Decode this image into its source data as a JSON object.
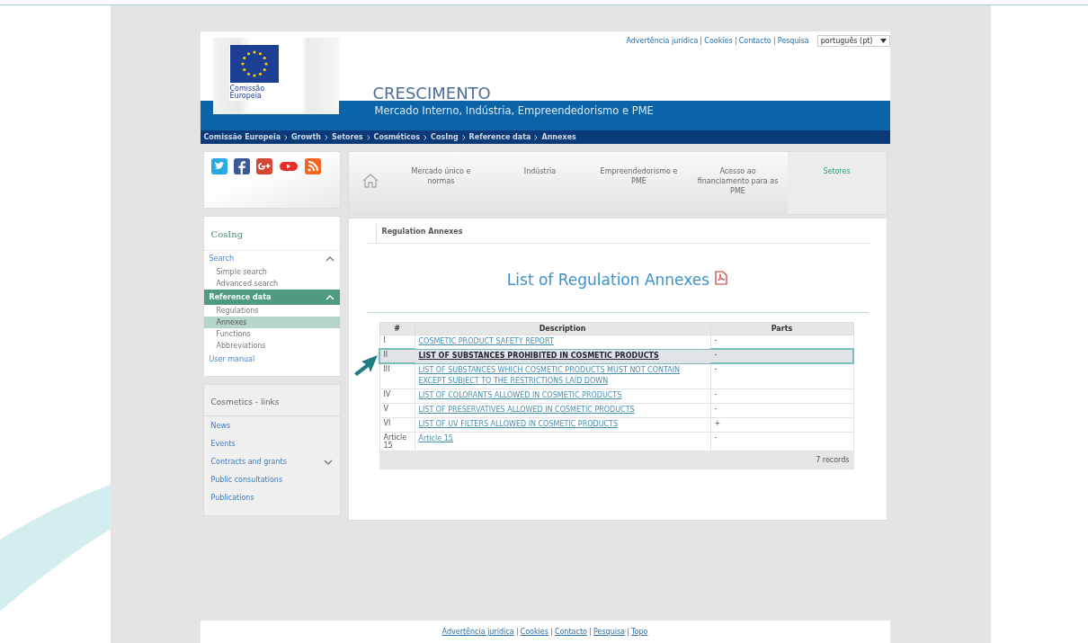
{
  "top_links": [
    "Advertência jurídica",
    "Cookies",
    "Contacto",
    "Pesquisa"
  ],
  "language_select": {
    "value": "português (pt)"
  },
  "logo_caption": "Comissão Europeia",
  "site_title": "CRESCIMENTO",
  "site_subtitle": "Mercado Interno, Indústria, Empreendedorismo e PME",
  "breadcrumb": [
    "Comissão Europeia",
    "Growth",
    "Setores",
    "Cosméticos",
    "CosIng",
    "Reference data",
    "Annexes"
  ],
  "social_icons": [
    {
      "kind": "twitter"
    },
    {
      "kind": "facebook"
    },
    {
      "kind": "googleplus"
    },
    {
      "kind": "youtube"
    },
    {
      "kind": "rss"
    }
  ],
  "nav": [
    {
      "label": "Mercado único e normas",
      "selected": false
    },
    {
      "label": "Indústria",
      "selected": false
    },
    {
      "label": "Empreendedorismo e PME",
      "selected": false
    },
    {
      "label": "Acesso ao financiamento para as PME",
      "selected": false
    },
    {
      "label": "Setores",
      "selected": true
    }
  ],
  "sidebar": {
    "title": "CosIng",
    "groups": [
      {
        "label": "Search",
        "kind": "section",
        "expanded": true,
        "active": false,
        "children": [
          {
            "label": "Simple search",
            "selected": false
          },
          {
            "label": "Advanced search",
            "selected": false
          }
        ]
      },
      {
        "label": "Reference data",
        "kind": "section",
        "expanded": true,
        "active": true,
        "children": [
          {
            "label": "Regulations",
            "selected": false
          },
          {
            "label": "Annexes",
            "selected": true
          },
          {
            "label": "Functions",
            "selected": false
          },
          {
            "label": "Abbreviations",
            "selected": false
          }
        ]
      },
      {
        "label": "User manual",
        "kind": "link",
        "active": false
      }
    ]
  },
  "links_box": {
    "title": "Cosmetics - links",
    "items": [
      {
        "label": "News",
        "kind": "link"
      },
      {
        "label": "Events",
        "kind": "link"
      },
      {
        "label": "Contracts and grants",
        "kind": "section",
        "expanded": false
      },
      {
        "label": "Public consultations",
        "kind": "link"
      },
      {
        "label": "Publications",
        "kind": "link"
      }
    ]
  },
  "tab": {
    "label": "Regulation Annexes"
  },
  "heading": "List of Regulation Annexes",
  "table": {
    "columns": [
      "#",
      "Description",
      "Parts"
    ],
    "rows": [
      {
        "number": "I",
        "description": "COSMETIC PRODUCT SAFETY REPORT",
        "parts": "-",
        "selected": false
      },
      {
        "number": "II",
        "description": "LIST OF SUBSTANCES PROHIBITED IN COSMETIC PRODUCTS",
        "parts": "-",
        "selected": true
      },
      {
        "number": "III",
        "description": "LIST OF SUBSTANCES WHICH COSMETIC PRODUCTS MUST NOT CONTAIN EXCEPT SUBJECT TO THE RESTRICTIONS LAID DOWN",
        "parts": "-",
        "selected": false
      },
      {
        "number": "IV",
        "description": "LIST OF COLORANTS ALLOWED IN COSMETIC PRODUCTS",
        "parts": "-",
        "selected": false
      },
      {
        "number": "V",
        "description": "LIST OF PRESERVATIVES ALLOWED IN COSMETIC PRODUCTS",
        "parts": "-",
        "selected": false
      },
      {
        "number": "VI",
        "description": "LIST OF UV FILTERS ALLOWED IN COSMETIC PRODUCTS",
        "parts": "+",
        "selected": false
      },
      {
        "number": "Article 15",
        "description": "Article 15",
        "parts": "-",
        "selected": false
      }
    ],
    "footer": "7 records"
  },
  "footer_links": [
    "Advertência jurídica",
    "Cookies",
    "Contacto",
    "Pesquisa",
    "Topo"
  ]
}
